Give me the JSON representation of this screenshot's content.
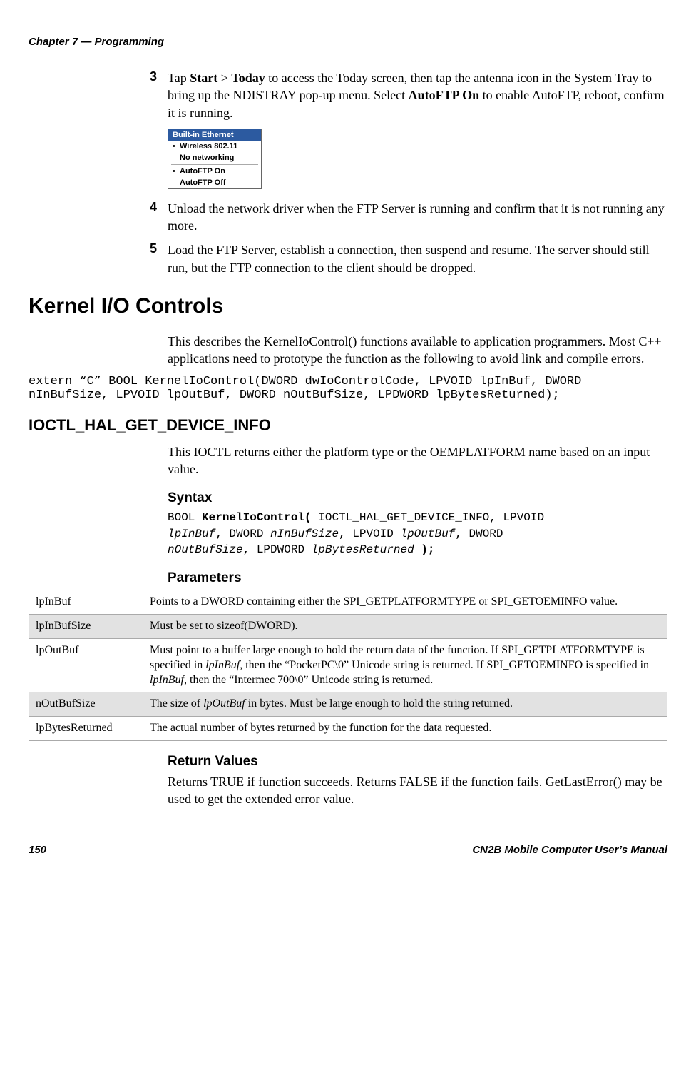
{
  "header": {
    "chapter": "Chapter 7 — Programming"
  },
  "steps": [
    {
      "num": "3",
      "html": "Tap <b>Start</b> > <b>Today</b> to access the Today screen, then tap the antenna icon in the System Tray to bring up the NDISTRAY pop-up menu. Select <b>AutoFTP On</b> to enable AutoFTP, reboot, confirm it is running."
    }
  ],
  "menu": {
    "title": "Built-in Ethernet",
    "items": [
      {
        "dot": "•",
        "label": "Wireless 802.11",
        "bold": true
      },
      {
        "dot": "",
        "label": "No networking",
        "bold": true
      },
      {
        "divider": true
      },
      {
        "dot": "•",
        "label": "AutoFTP On",
        "bold": true
      },
      {
        "dot": "",
        "label": "AutoFTP Off",
        "bold": true
      }
    ]
  },
  "steps2": [
    {
      "num": "4",
      "html": "Unload the network driver when the FTP Server is running and confirm that it is not running any more."
    },
    {
      "num": "5",
      "html": "Load the FTP Server, establish a connection, then suspend and resume. The server should still run, but the FTP connection to the client should be dropped."
    }
  ],
  "section_kernel": {
    "title": "Kernel I/O Controls",
    "body": "This describes the KernelIoControl() functions available to application programmers. Most C++ applications need to prototype the function as the following to avoid link and compile errors.",
    "code": "extern “C” BOOL KernelIoControl(DWORD dwIoControlCode, LPVOID lpInBuf, DWORD\nnInBufSize, LPVOID lpOutBuf, DWORD nOutBufSize, LPDWORD lpBytesReturned);"
  },
  "ioctl": {
    "title": "IOCTL_HAL_GET_DEVICE_INFO",
    "body": "This IOCTL returns either the platform type or the OEMPLATFORM name based on an input value.",
    "syntax_label": "Syntax",
    "syntax_parts": {
      "pre1": "BOOL ",
      "kw1": "KernelIoControl(",
      "mid1": " IOCTL_HAL_GET_DEVICE_INFO, LPVOID",
      "p1": "lpInBuf",
      "c1": ", DWORD ",
      "p2": "nInBufSize",
      "c2": ", LPVOID ",
      "p3": "lpOutBuf",
      "c3": ", DWORD",
      "p4": "nOutBufSize",
      "c4": ", LPDWORD ",
      "p5": "lpBytesReturned",
      "end": " );"
    },
    "params_label": "Parameters",
    "params": [
      {
        "name": "lpInBuf",
        "desc": "Points to a DWORD containing either the SPI_GETPLATFORMTYPE or SPI_GETOEMINFO value.",
        "shade": false
      },
      {
        "name": "lpInBufSize",
        "desc": "Must be set to sizeof(DWORD).",
        "shade": true
      },
      {
        "name": "lpOutBuf",
        "desc_html": "Must point to a buffer large enough to hold the return data of the function. If SPI_GETPLATFORMTYPE is specified in <i>lpInBuf</i>, then the “PocketPC\\0” Unicode string is returned. If SPI_GETOEMINFO is specified in <i>lpInBuf</i>, then the “Intermec 700\\0” Unicode string is returned.",
        "shade": false
      },
      {
        "name": "nOutBufSize",
        "desc_html": "The size of <i>lpOutBuf</i> in bytes. Must be large enough to hold the string returned.",
        "shade": true
      },
      {
        "name": "lpBytesReturned",
        "desc": "The actual number of bytes returned by the function for the data requested.",
        "shade": false
      }
    ],
    "return_label": "Return Values",
    "return_body": "Returns TRUE if function succeeds. Returns FALSE if the function fails. GetLastError() may be used to get the extended error value."
  },
  "footer": {
    "page": "150",
    "title": "CN2B Mobile Computer User’s Manual"
  }
}
